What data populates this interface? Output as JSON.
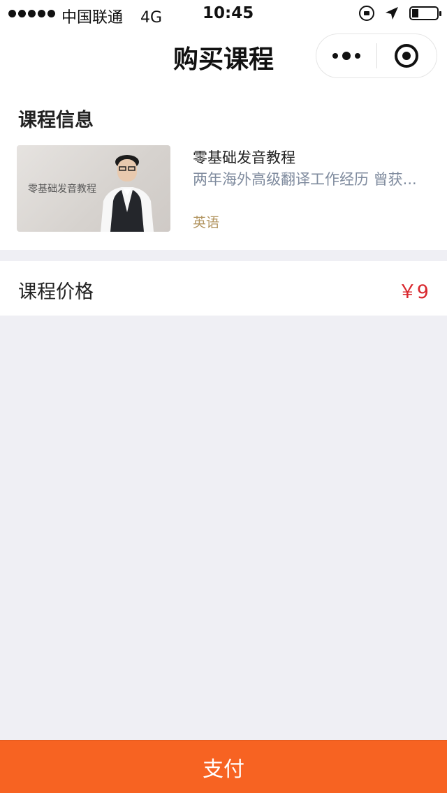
{
  "status_bar": {
    "carrier": "中国联通",
    "network": "4G",
    "time": "10:45"
  },
  "nav": {
    "title": "购买课程"
  },
  "course_info": {
    "section_title": "课程信息",
    "thumbnail_text": "零基础发音教程",
    "name": "零基础发音教程",
    "description": "两年海外高级翻译工作经历 曾获...",
    "tag": "英语"
  },
  "price": {
    "label": "课程价格",
    "value": "￥9"
  },
  "footer": {
    "pay_label": "支付"
  },
  "colors": {
    "accent": "#f76322",
    "price": "#d9282e",
    "tag": "#b39662",
    "description": "#7f8b9e",
    "background": "#efeff4"
  },
  "icons": [
    "signal-icon",
    "lock-rotation-icon",
    "location-arrow-icon",
    "battery-icon",
    "more-icon",
    "target-icon"
  ]
}
